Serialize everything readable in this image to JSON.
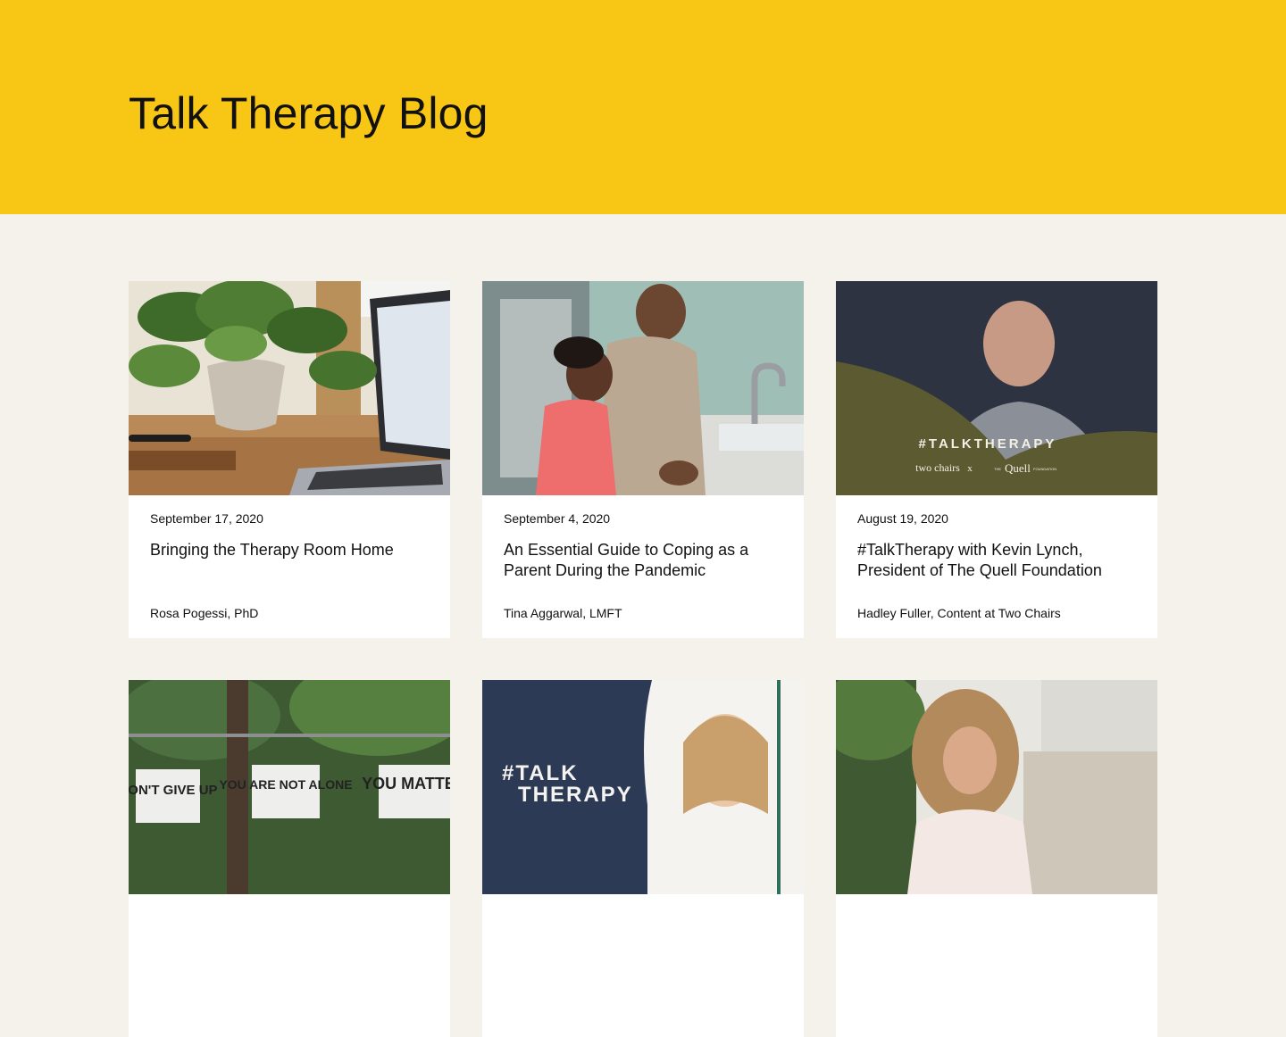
{
  "hero": {
    "title": "Talk Therapy Blog",
    "background": "#f8c614"
  },
  "posts": [
    {
      "date": "September 17, 2020",
      "title": "Bringing the Therapy Room Home",
      "author": "Rosa Pogessi, PhD",
      "image": "plant-and-laptop-photo"
    },
    {
      "date": "September 4, 2020",
      "title": "An Essential Guide to Coping as a Parent During the Pandemic",
      "author": "Tina Aggarwal, LMFT",
      "image": "parent-and-child-washing-hands-photo"
    },
    {
      "date": "August 19, 2020",
      "title": "#TalkTherapy with Kevin Lynch, President of The Quell Foundation",
      "author": "Hadley Fuller, Content at Two Chairs",
      "image": "talktherapy-portrait-banner",
      "banner": {
        "headline": "#TALKTHERAPY",
        "brand": "two chairs",
        "separator": "x",
        "partner_prefix": "THE",
        "partner": "Quell",
        "partner_suffix": "FOUNDATION"
      }
    },
    {
      "image": "fence-signs-photo",
      "signs": [
        "DON'T GIVE UP",
        "YOU ARE NOT ALONE",
        "YOU MATTER"
      ]
    },
    {
      "image": "talktherapy-woman-banner",
      "banner": {
        "line1": "#TALK",
        "line2": "THERAPY"
      }
    },
    {
      "image": "woman-on-couch-photo"
    }
  ]
}
